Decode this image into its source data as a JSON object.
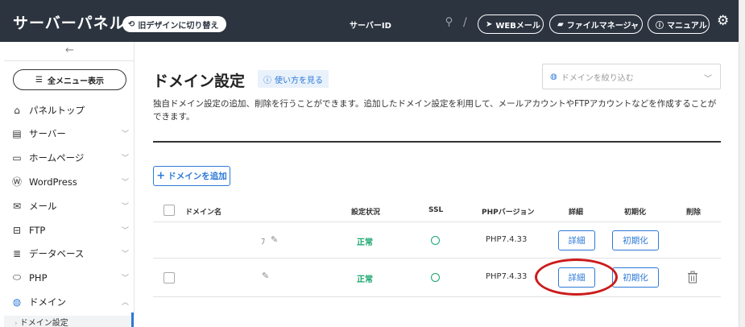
{
  "header": {
    "app_title": "サーバーパネル",
    "switch_design": "旧デザインに切り替え",
    "server_id": "サーバーID",
    "web_mail": "WEBメール",
    "file_manager": "ファイルマネージャ",
    "manual": "マニュアル"
  },
  "sidebar": {
    "all_menu": "全メニュー表示",
    "items": [
      {
        "label": "パネルトップ",
        "icon": "home-icon"
      },
      {
        "label": "サーバー",
        "icon": "server-icon"
      },
      {
        "label": "ホームページ",
        "icon": "window-icon"
      },
      {
        "label": "WordPress",
        "icon": "wordpress-icon"
      },
      {
        "label": "メール",
        "icon": "mail-icon"
      },
      {
        "label": "FTP",
        "icon": "ftp-icon"
      },
      {
        "label": "データベース",
        "icon": "database-icon"
      },
      {
        "label": "PHP",
        "icon": "php-icon"
      },
      {
        "label": "ドメイン",
        "icon": "globe-icon"
      }
    ],
    "sub_active": "ドメイン設定"
  },
  "main": {
    "title": "ドメイン設定",
    "howto": "使い方を見る",
    "filter_placeholder": "ドメインを絞り込む",
    "description": "独自ドメイン設定の追加、削除を行うことができます。追加したドメイン設定を利用して、メールアカウントやFTPアカウントなどを作成することができます。",
    "add_button": "ドメインを追加"
  },
  "table": {
    "headers": {
      "domain": "ドメイン名",
      "status": "設定状況",
      "ssl": "SSL",
      "php": "PHPバージョン",
      "detail": "詳細",
      "init": "初期化",
      "delete": "削除"
    },
    "rows": [
      {
        "domain_fragment": "ﾌ",
        "status": "正常",
        "php": "PHP7.4.33",
        "detail": "詳細",
        "init": "初期化"
      },
      {
        "domain_fragment": "",
        "status": "正常",
        "php": "PHP7.4.33",
        "detail": "詳細",
        "init": "初期化"
      }
    ]
  },
  "colors": {
    "header_bg": "#2c3440",
    "accent": "#2d7ad6",
    "ok_green": "#1aa56d",
    "highlight_red": "#cc1b1b"
  }
}
